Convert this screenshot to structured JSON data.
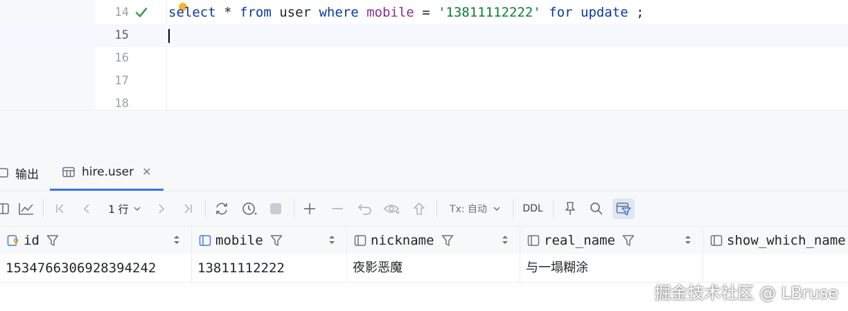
{
  "editor": {
    "lines": [
      {
        "number": "14",
        "tokens": [
          "select",
          "*",
          "from",
          "user",
          "where",
          "mobile",
          "=",
          "'13811112222'",
          "for update",
          ";"
        ]
      },
      {
        "number": "15"
      },
      {
        "number": "16"
      },
      {
        "number": "17"
      },
      {
        "number": "18"
      }
    ]
  },
  "tabs": [
    {
      "label": "输出",
      "icon": "output-icon"
    },
    {
      "label": "hire.user",
      "icon": "table-icon",
      "active": true
    }
  ],
  "toolbar": {
    "rows_label": "1 行",
    "tx_label": "Tx: 自动",
    "ddl_label": "DDL"
  },
  "grid": {
    "columns": [
      "id",
      "mobile",
      "nickname",
      "real_name",
      "show_which_name"
    ],
    "rows": [
      [
        "1534766306928394242",
        "13811112222",
        "夜影恶魔",
        "与一塌糊涂",
        ""
      ]
    ]
  },
  "watermark": "掘金技术社区 @ LBruse",
  "colors": {
    "accent": "#3574f0",
    "keyword": "#0b36a8",
    "string": "#0a7d34",
    "column": "#8a2f9a",
    "check": "#3d9a57"
  }
}
